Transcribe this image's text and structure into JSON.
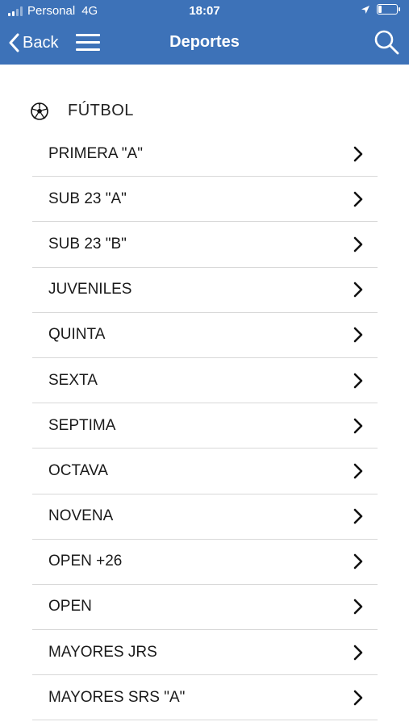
{
  "status_bar": {
    "carrier": "Personal",
    "network": "4G",
    "time": "18:07",
    "signal_bars_active": 2,
    "signal_bars_total": 4,
    "battery_level": 0.2
  },
  "nav": {
    "back_label": "Back",
    "title": "Deportes"
  },
  "section": {
    "title": "FÚTBOL",
    "icon": "soccer-ball-icon"
  },
  "items": [
    {
      "label": "PRIMERA \"A\""
    },
    {
      "label": "SUB 23 \"A\""
    },
    {
      "label": "SUB 23 \"B\""
    },
    {
      "label": "JUVENILES"
    },
    {
      "label": "QUINTA"
    },
    {
      "label": "SEXTA"
    },
    {
      "label": "SEPTIMA"
    },
    {
      "label": "OCTAVA"
    },
    {
      "label": "NOVENA"
    },
    {
      "label": "OPEN +26"
    },
    {
      "label": "OPEN"
    },
    {
      "label": "MAYORES JRS"
    },
    {
      "label": "MAYORES SRS \"A\""
    }
  ],
  "colors": {
    "header_bg": "#3d72b8",
    "divider": "#d8d8d8"
  }
}
